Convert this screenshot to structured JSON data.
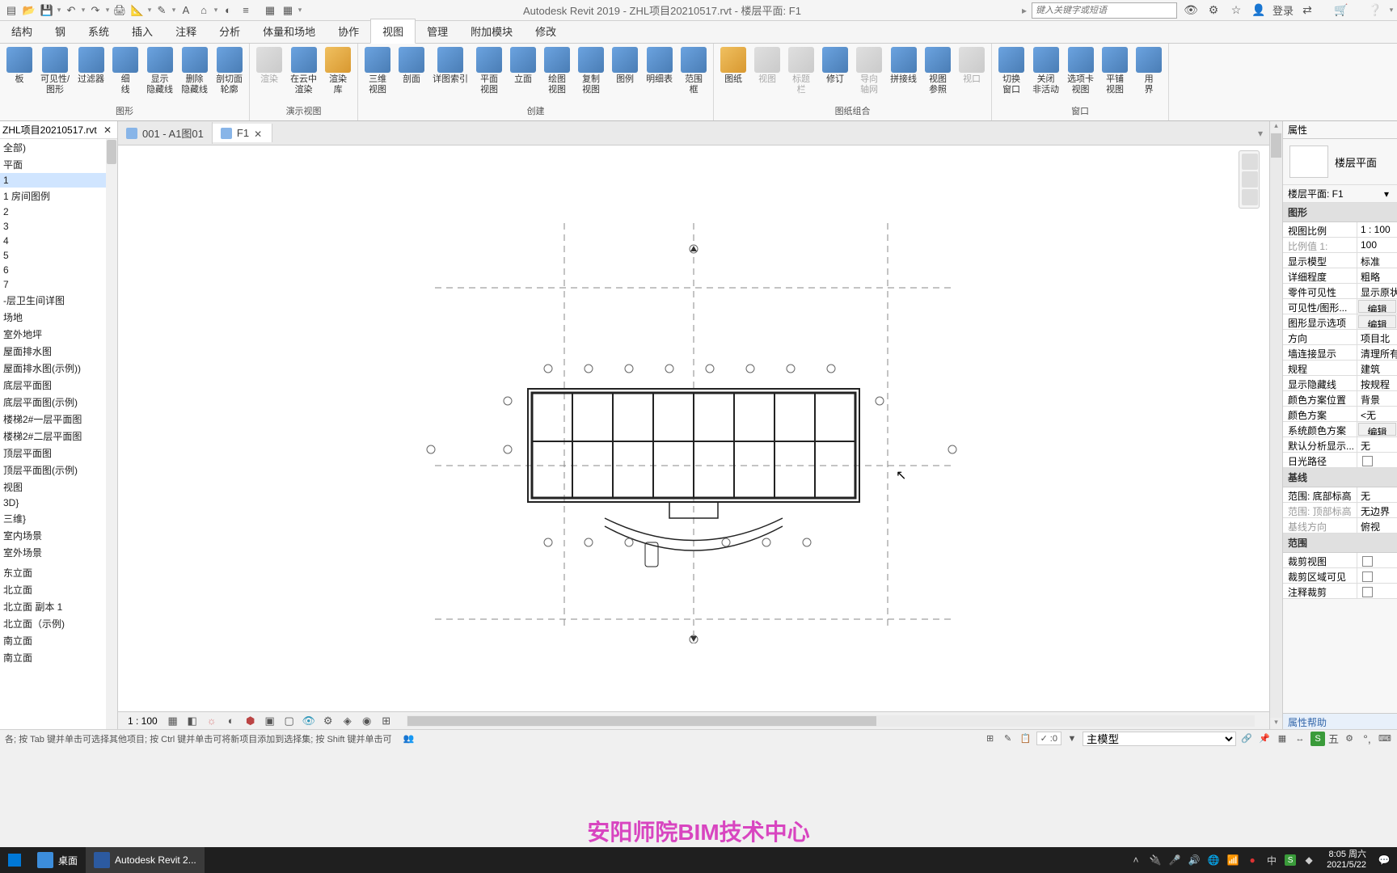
{
  "title": "Autodesk Revit 2019 - ZHL项目20210517.rvt - 楼层平面: F1",
  "search": {
    "placeholder": "键入关键字或短语"
  },
  "login": "登录",
  "ribbonTabs": [
    "结构",
    "钢",
    "系统",
    "插入",
    "注释",
    "分析",
    "体量和场地",
    "协作",
    "视图",
    "管理",
    "附加模块",
    "修改"
  ],
  "activeTab": 8,
  "ribbon": {
    "g1": {
      "label": "图形",
      "items": [
        "板",
        "可见性/\n图形",
        "过滤器",
        "细\n线",
        "显示\n隐藏线",
        "删除\n隐藏线",
        "剖切面\n轮廓"
      ]
    },
    "g2": {
      "label": "演示视图",
      "items": [
        "渲染",
        "在云中\n渲染",
        "渲染\n库"
      ]
    },
    "g3": {
      "label": "创建",
      "items": [
        "三维\n视图",
        "剖面",
        "详图索引",
        "平面\n视图",
        "立面",
        "绘图\n视图",
        "复制\n视图",
        "图例",
        "明细表",
        "范围\n框"
      ]
    },
    "g4": {
      "label": "图纸组合",
      "items": [
        "图纸",
        "视图",
        "标题\n栏",
        "修订",
        "导向\n轴网",
        "拼接线",
        "视图\n参照",
        "视口"
      ]
    },
    "g5": {
      "label": "窗口",
      "items": [
        "切换\n窗口",
        "关闭\n非活动",
        "选项卡\n视图",
        "平铺\n视图",
        "用\n界"
      ]
    }
  },
  "leftHeader": "ZHL项目20210517.rvt",
  "tree": [
    "全部)",
    "平面",
    "1",
    "1 房间图例",
    "2",
    "3",
    "4",
    "5",
    "6",
    "7",
    "-层卫生间详图",
    "场地",
    "室外地坪",
    "屋面排水图",
    "屋面排水图(示例))",
    "底层平面图",
    "底层平面图(示例)",
    "楼梯2#一层平面图",
    "楼梯2#二层平面图",
    "顶层平面图",
    "顶层平面图(示例)",
    "视图",
    "3D}",
    "三维}",
    "室内场景",
    "室外场景",
    "",
    "东立面",
    "北立面",
    "北立面 副本 1",
    "北立面（示例)",
    "南立面",
    "南立面"
  ],
  "treeSelected": 2,
  "viewTabs": [
    {
      "label": "001 - A1图01",
      "active": false
    },
    {
      "label": "F1",
      "active": true
    }
  ],
  "viewScale": "1 : 100",
  "props": {
    "header": "属性",
    "typeLabel": "楼层平面",
    "instance": "楼层平面: F1",
    "sections": [
      {
        "name": "图形",
        "rows": [
          {
            "n": "视图比例",
            "v": "1 : 100"
          },
          {
            "n": "比例值 1:",
            "v": "100",
            "d": true
          },
          {
            "n": "显示模型",
            "v": "标准"
          },
          {
            "n": "详细程度",
            "v": "粗略"
          },
          {
            "n": "零件可见性",
            "v": "显示原状"
          },
          {
            "n": "可见性/图形...",
            "v": "编辑",
            "btn": true
          },
          {
            "n": "图形显示选项",
            "v": "编辑",
            "btn": true
          },
          {
            "n": "方向",
            "v": "项目北"
          },
          {
            "n": "墙连接显示",
            "v": "清理所有"
          },
          {
            "n": "规程",
            "v": "建筑"
          },
          {
            "n": "显示隐藏线",
            "v": "按规程"
          },
          {
            "n": "颜色方案位置",
            "v": "背景"
          },
          {
            "n": "颜色方案",
            "v": "<无"
          },
          {
            "n": "系统颜色方案",
            "v": "编辑",
            "btn": true
          },
          {
            "n": "默认分析显示...",
            "v": "无"
          },
          {
            "n": "日光路径",
            "v": "",
            "check": true
          }
        ]
      },
      {
        "name": "基线",
        "rows": [
          {
            "n": "范围: 底部标高",
            "v": "无"
          },
          {
            "n": "范围: 顶部标高",
            "v": "无边界",
            "d": true
          },
          {
            "n": "基线方向",
            "v": "俯视",
            "d": true
          }
        ]
      },
      {
        "name": "范围",
        "rows": [
          {
            "n": "裁剪视图",
            "v": "",
            "check": true
          },
          {
            "n": "裁剪区域可见",
            "v": "",
            "check": true
          },
          {
            "n": "注释裁剪",
            "v": "",
            "check": true
          }
        ]
      }
    ],
    "footer": "属性帮助"
  },
  "statusHint": "各; 按 Tab 键并单击可选择其他项目; 按 Ctrl 键并单击可将新项目添加到选择集; 按 Shift 键并单击可",
  "statusCount": ":0",
  "statusSel": "主模型",
  "statusBadge": "五",
  "watermark": "安阳师院BIM技术中心",
  "taskbar": {
    "desktop": "桌面",
    "revit": "Autodesk Revit 2...",
    "time": "8:05 周六",
    "date": "2021/5/22"
  }
}
